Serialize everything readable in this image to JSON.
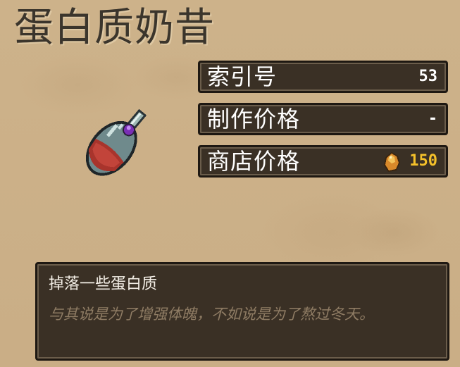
{
  "item": {
    "title": "蛋白质奶昔",
    "icon": "potion-flask-icon"
  },
  "stats": [
    {
      "label": "索引号",
      "value": "53"
    },
    {
      "label": "制作价格",
      "value": "-"
    },
    {
      "label": "商店价格",
      "value": "150",
      "icon": "gold-coin-icon"
    }
  ],
  "description": {
    "text": "掉落一些蛋白质",
    "flavor": "与其说是为了增强体魄，不如说是为了熬过冬天。"
  },
  "colors": {
    "panel_bg": "#3a3025",
    "gold_text": "#f5c12a",
    "parchment": "#cdb28a",
    "flavor_text": "#8f7c64"
  }
}
